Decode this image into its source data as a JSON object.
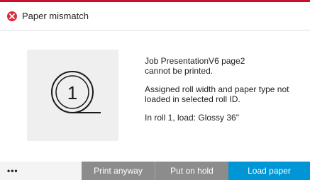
{
  "colors": {
    "accent_red": "#c8102e",
    "error_red": "#e0293a",
    "primary_blue": "#0096d6",
    "button_gray": "#8c8c8c"
  },
  "header": {
    "icon": "error-circle-x-icon",
    "title": "Paper mismatch"
  },
  "illustration": {
    "icon": "paper-roll-icon",
    "roll_number": "1"
  },
  "message": {
    "line1": "Job PresentationV6 page2",
    "line2": "cannot be printed.",
    "line3": "Assigned roll width and paper type not",
    "line4": "loaded in selected roll ID.",
    "line5": "In roll 1, load: Glossy 36\""
  },
  "actions": {
    "more_label": "•••",
    "print_anyway": "Print anyway",
    "put_on_hold": "Put on hold",
    "load_paper": "Load paper"
  }
}
